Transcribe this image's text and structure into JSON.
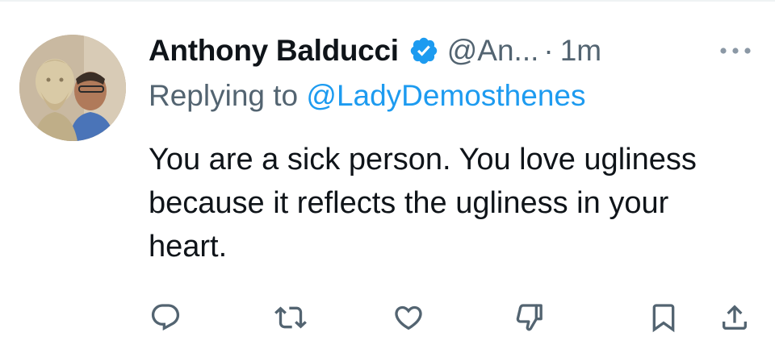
{
  "tweet": {
    "display_name": "Anthony Balducci",
    "handle": "@An...",
    "separator": "·",
    "time": "1m",
    "replying_prefix": "Replying to ",
    "replying_to": "@LadyDemosthenes",
    "text": "You are a sick person.  You love ugliness because it reflects the ugliness in your heart.",
    "verified": true
  },
  "icons": {
    "verified": "verified-badge-icon",
    "more": "more-icon",
    "reply": "reply-icon",
    "retweet": "retweet-icon",
    "like": "like-icon",
    "dislike": "dislike-icon",
    "bookmark": "bookmark-icon",
    "share": "share-icon"
  },
  "colors": {
    "text": "#0f1419",
    "secondary": "#536471",
    "link": "#1d9bf0",
    "verified": "#1d9bf0"
  }
}
